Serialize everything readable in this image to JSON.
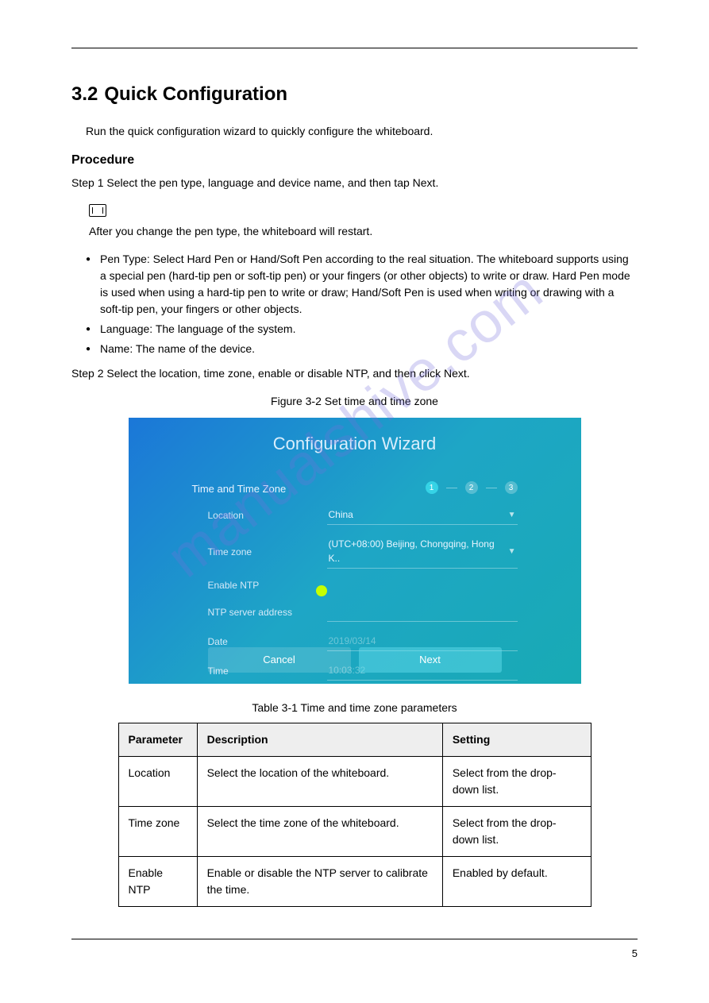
{
  "page": {
    "section_number": "3.2",
    "section_title": "Quick Configuration",
    "intro": "Run the quick configuration wizard to quickly configure the whiteboard.",
    "procedure_heading": "Procedure",
    "step1": "Step 1   Select the pen type, language and device name, and then tap Next.",
    "note_text": "After you change the pen type, the whiteboard will restart.",
    "bullet1": "Pen Type: Select Hard Pen or Hand/Soft Pen according to the real situation. The whiteboard supports using a special pen (hard-tip pen or soft-tip pen) or your fingers (or other objects) to write or draw. Hard Pen mode is used when using a hard-tip pen to write or draw; Hand/Soft Pen is used when writing or drawing with a soft-tip pen, your fingers or other objects.",
    "bullet2": "Language: The language of the system.",
    "bullet3": "Name: The name of the device.",
    "step2": "Step 2   Select the location, time zone, enable or disable NTP, and then click Next.",
    "figure_caption": "Figure 3-2 Set time and time zone",
    "table_caption": "Table 3-1 Time and time zone parameters",
    "page_number": "5"
  },
  "wizard": {
    "title": "Configuration Wizard",
    "section": "Time and Time Zone",
    "steps": [
      "1",
      "2",
      "3"
    ],
    "location_label": "Location",
    "location_value": "China",
    "timezone_label": "Time zone",
    "timezone_value": "(UTC+08:00) Beijing, Chongqing, Hong K..",
    "ntp_label": "Enable NTP",
    "ntp_addr_label": "NTP server address",
    "date_label": "Date",
    "date_value": "2019/03/14",
    "time_label": "Time",
    "time_value": "10:03:32",
    "cancel": "Cancel",
    "next": "Next"
  },
  "table": {
    "headers": [
      "Parameter",
      "Description",
      "Setting"
    ],
    "rows": [
      [
        "Location",
        "Select the location of the whiteboard.",
        "Select from the drop-down list."
      ],
      [
        "Time zone",
        "Select the time zone of the whiteboard.",
        "Select from the drop-down list."
      ],
      [
        "Enable NTP",
        "Enable or disable the NTP server to calibrate the time.",
        "Enabled by default."
      ]
    ]
  },
  "watermark": "manualshive.com"
}
